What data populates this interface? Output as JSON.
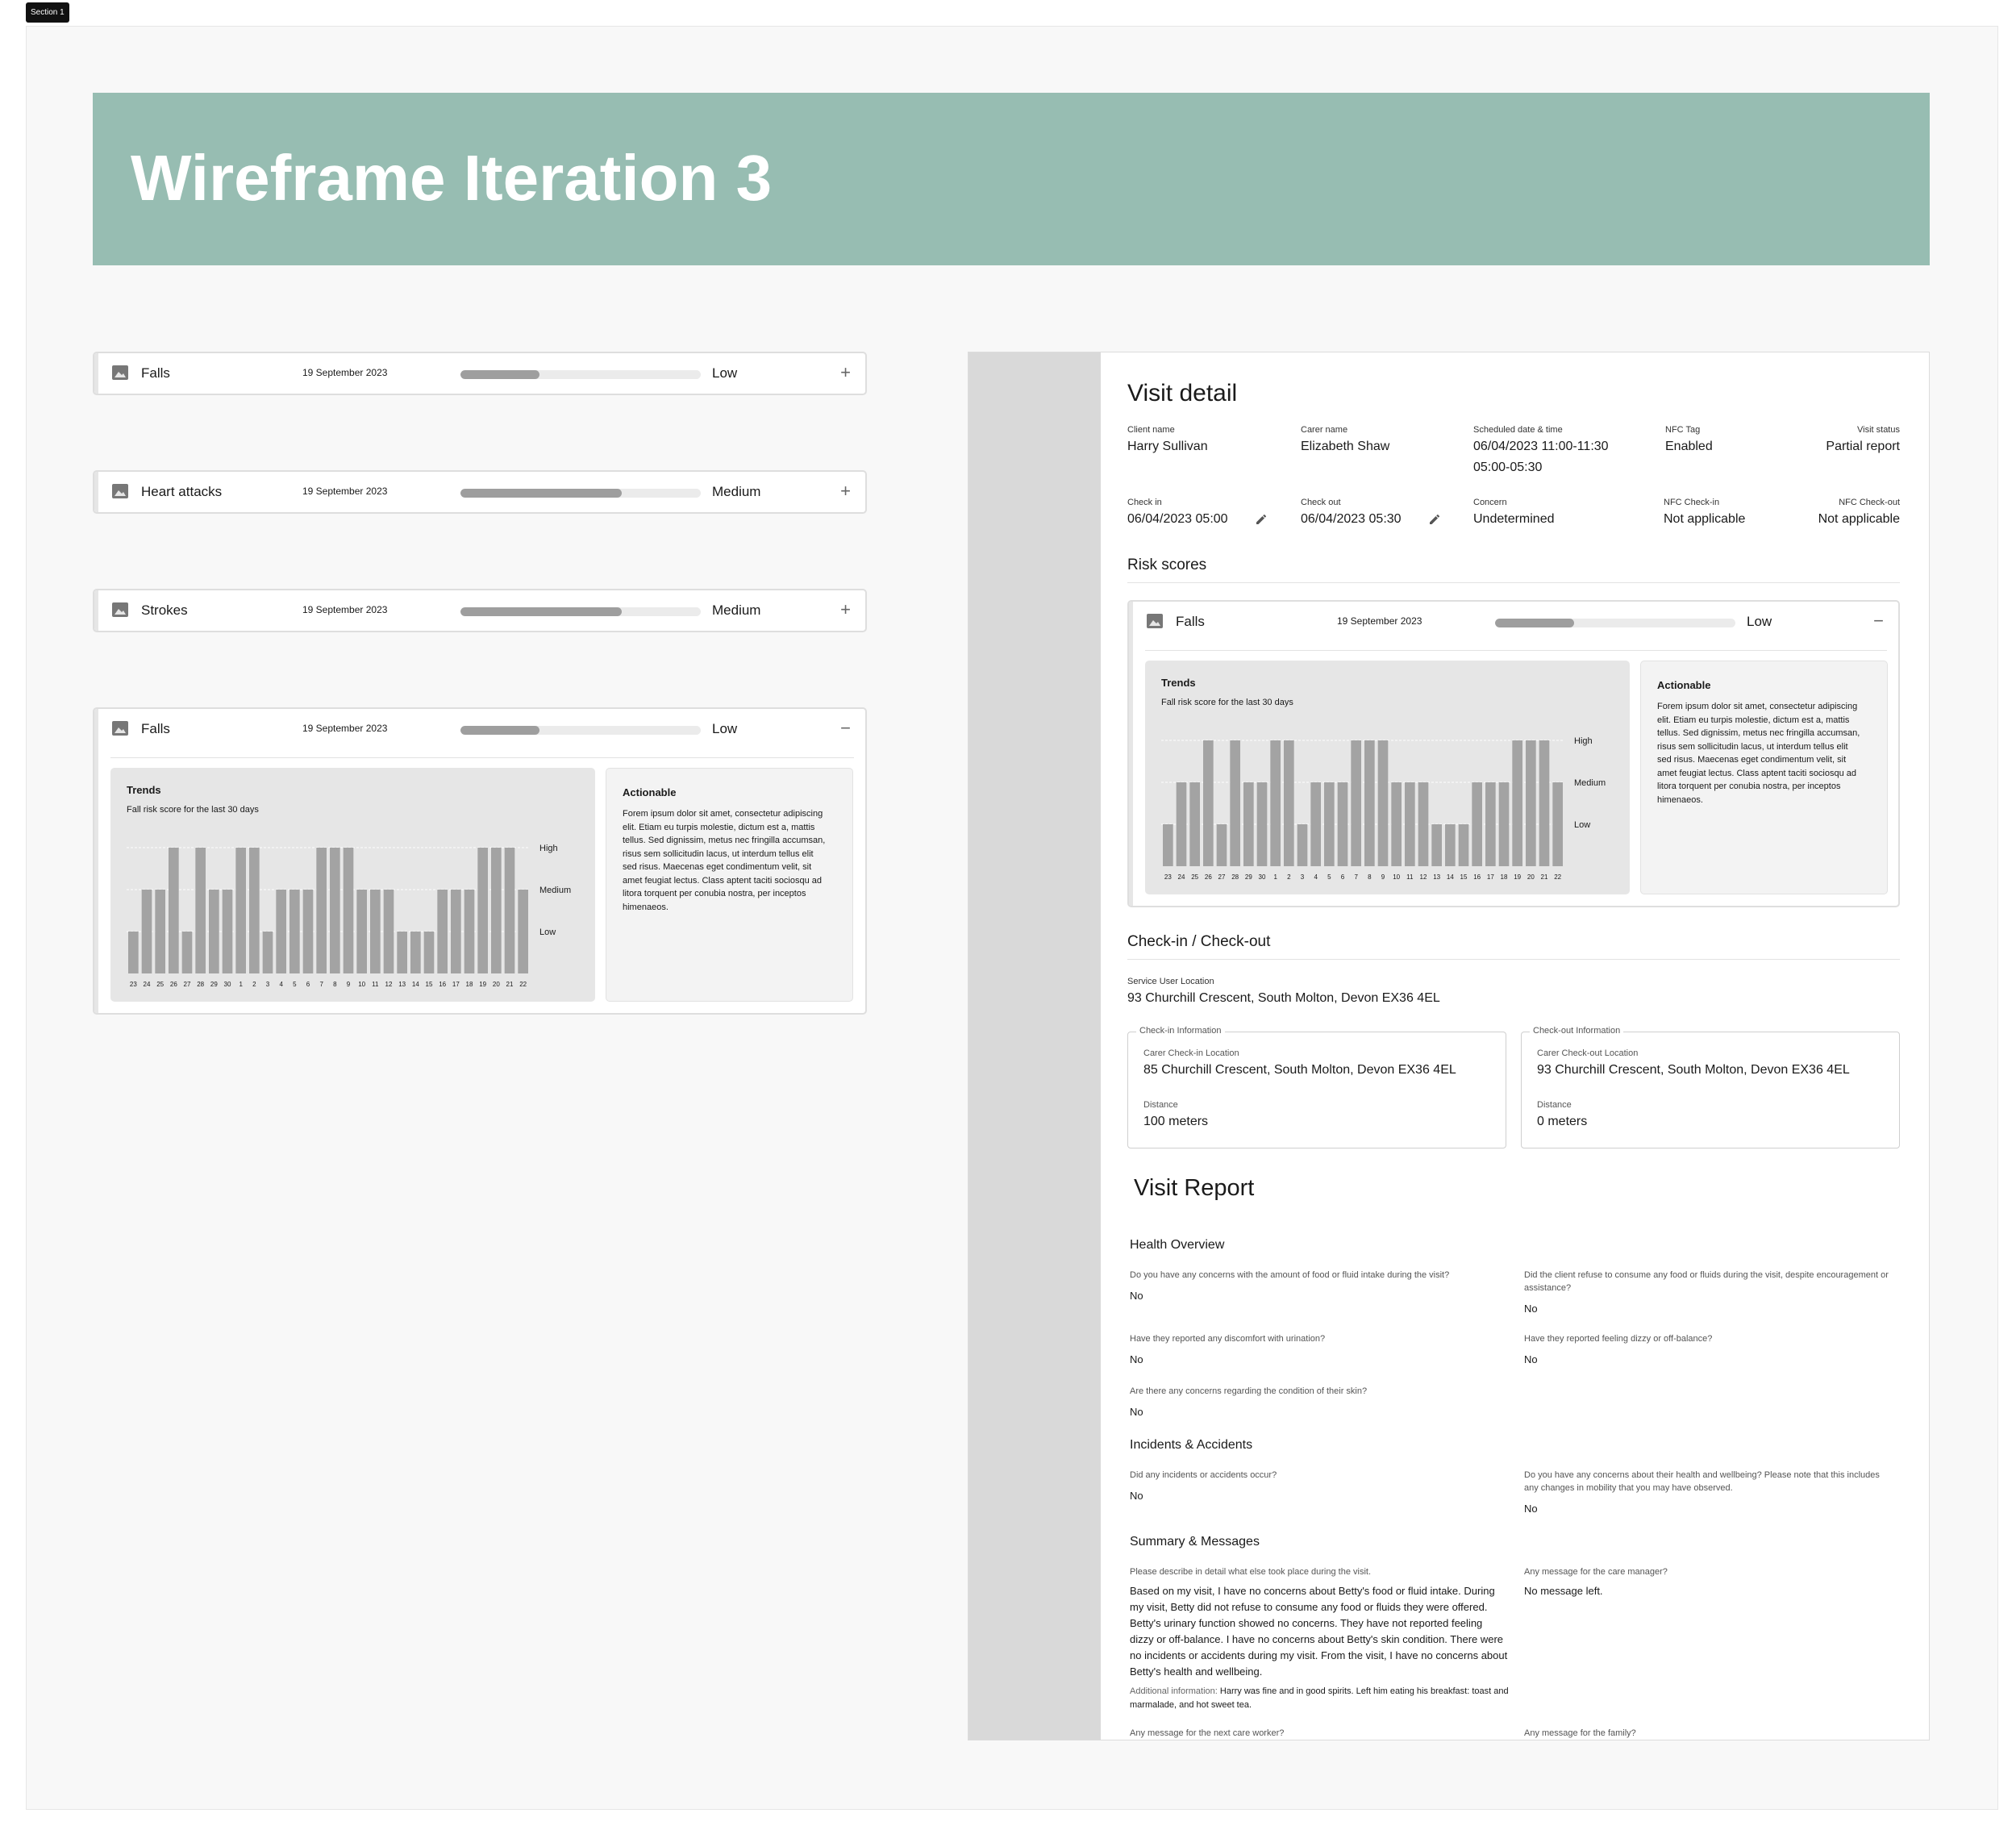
{
  "section_label": "Section 1",
  "banner": {
    "title": "Wireframe Iteration 3"
  },
  "risk_cards": [
    {
      "title": "Falls",
      "date": "19 September 2023",
      "level": "Low",
      "level_value": 0.33,
      "toggle": "+"
    },
    {
      "title": "Heart attacks",
      "date": "19 September 2023",
      "level": "Medium",
      "level_value": 0.67,
      "toggle": "+"
    },
    {
      "title": "Strokes",
      "date": "19 September 2023",
      "level": "Medium",
      "level_value": 0.67,
      "toggle": "+"
    },
    {
      "title": "Falls",
      "date": "19 September 2023",
      "level": "Low",
      "level_value": 0.33,
      "toggle": "−"
    }
  ],
  "trends": {
    "title": "Trends",
    "subtitle": "Fall risk score for the last 30 days",
    "actionable_title": "Actionable",
    "actionable_text": "Forem ipsum dolor sit amet, consectetur adipiscing elit. Etiam eu turpis molestie, dictum est a, mattis tellus. Sed dignissim, metus nec fringilla accumsan, risus sem sollicitudin lacus, ut interdum tellus elit sed risus. Maecenas eget condimentum velit, sit amet feugiat lectus. Class aptent taciti sociosqu ad litora torquent per conubia nostra, per inceptos himenaeos."
  },
  "chart_data": {
    "type": "bar",
    "title": "Trends",
    "subtitle": "Fall risk score for the last 30 days",
    "categories": [
      "23",
      "24",
      "25",
      "26",
      "27",
      "28",
      "29",
      "30",
      "1",
      "2",
      "3",
      "4",
      "5",
      "6",
      "7",
      "8",
      "9",
      "10",
      "11",
      "12",
      "13",
      "14",
      "15",
      "16",
      "17",
      "18",
      "19",
      "20",
      "21",
      "22"
    ],
    "values": [
      1,
      2,
      2,
      3,
      1,
      3,
      2,
      2,
      3,
      3,
      1,
      2,
      2,
      2,
      3,
      3,
      3,
      2,
      2,
      2,
      1,
      1,
      1,
      2,
      2,
      2,
      3,
      3,
      3,
      2
    ],
    "y_levels": [
      "Low",
      "Medium",
      "High"
    ],
    "ylim": [
      0,
      3
    ],
    "grid": true
  },
  "visit": {
    "heading": "Visit detail",
    "client_name_label": "Client name",
    "client_name": "Harry Sullivan",
    "carer_name_label": "Carer name",
    "carer_name": "Elizabeth Shaw",
    "scheduled_label": "Scheduled date & time",
    "scheduled_line1": "06/04/2023  11:00-11:30",
    "scheduled_line2": "05:00-05:30",
    "nfc_tag_label": "NFC Tag",
    "nfc_tag": "Enabled",
    "status_label": "Visit status",
    "status": "Partial report",
    "check_in_label": "Check in",
    "check_in": "06/04/2023 05:00",
    "check_out_label": "Check out",
    "check_out": "06/04/2023 05:30",
    "concern_label": "Concern",
    "concern": "Undetermined",
    "nfc_in_label": "NFC Check-in",
    "nfc_in": "Not applicable",
    "nfc_out_label": "NFC Check-out",
    "nfc_out": "Not applicable",
    "risk_scores_heading": "Risk scores",
    "checkin_heading": "Check-in / Check-out",
    "service_location_label": "Service User Location",
    "service_location": "93 Churchill Crescent, South Molton, Devon EX36 4EL",
    "checkin_box": {
      "legend": "Check-in Information",
      "loc_label": "Carer Check-in Location",
      "loc": "85 Churchill Crescent, South Molton, Devon EX36 4EL",
      "dist_label": "Distance",
      "dist": "100 meters"
    },
    "checkout_box": {
      "legend": "Check-out Information",
      "loc_label": "Carer Check-out Location",
      "loc": "93 Churchill Crescent, South Molton, Devon EX36 4EL",
      "dist_label": "Distance",
      "dist": "0 meters"
    }
  },
  "report": {
    "title": "Visit Report",
    "health_heading": "Health Overview",
    "q_food": "Do you have any concerns with the amount of food or fluid intake during the visit?",
    "a_food": "No",
    "q_refuse": "Did the client refuse to consume any food or fluids during the visit, despite encouragement or assistance?",
    "a_refuse": "No",
    "q_urination": "Have they reported any discomfort with urination?",
    "a_urination": "No",
    "q_dizzy": "Have they reported feeling dizzy or off-balance?",
    "a_dizzy": "No",
    "q_skin": "Are there any concerns regarding the condition of their skin?",
    "a_skin": "No",
    "incidents_heading": "Incidents & Accidents",
    "q_incidents": "Did any incidents or accidents occur?",
    "a_incidents": "No",
    "q_health": "Do you have any concerns about their health and wellbeing? Please note that this includes any changes in mobility that you may have observed.",
    "a_health": "No",
    "summary_heading": "Summary & Messages",
    "q_describe": "Please describe in detail what else took place during the visit.",
    "a_describe": "Based on my visit, I have no concerns about Betty's food or fluid intake. During my visit, Betty did not refuse to consume any food or fluids they were offered. Betty's urinary function showed no concerns. They have not reported feeling dizzy or off-balance. I have no concerns about Betty's skin condition. There were no incidents or accidents during my visit. From the visit, I have no concerns about Betty's health and wellbeing.",
    "additional_label": "Additional information:",
    "additional_text": "Harry was fine and in good spirits. Left him eating his breakfast: toast and marmalade, and hot sweet tea.",
    "q_manager": "Any message for the care manager?",
    "a_manager": "No message left.",
    "q_next_worker": "Any message for the next care worker?",
    "q_family": "Any message for the family?"
  },
  "colors": {
    "banner": "#97bdb2",
    "bar": "#9e9e9e",
    "track": "#ebebeb",
    "side": "#d9d9d9"
  }
}
